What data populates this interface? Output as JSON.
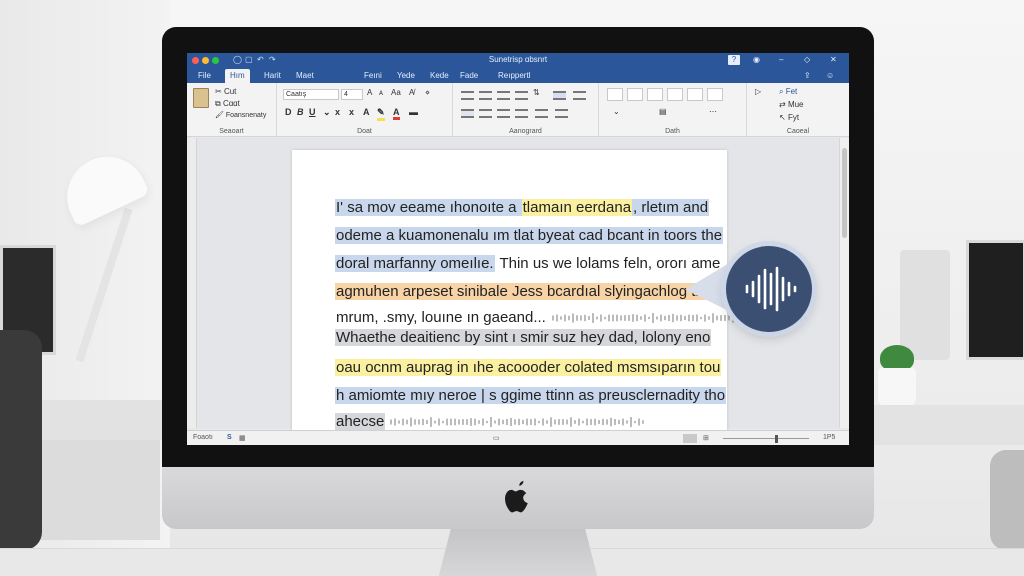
{
  "window": {
    "title": "Sunetrisp ɑbsnrt",
    "ctrl_help": "?",
    "ctrl_min": "–",
    "ctrl_max": "◇",
    "ctrl_close": "✕"
  },
  "tabs": [
    {
      "label": "File"
    },
    {
      "label": "Hım",
      "active": true
    },
    {
      "label": "Harit"
    },
    {
      "label": "Maet"
    },
    {
      "label": "Feıni"
    },
    {
      "label": "Yede"
    },
    {
      "label": "Kede"
    },
    {
      "label": "Fade"
    },
    {
      "label": "Reıppertl"
    }
  ],
  "ribbon": {
    "clipboard": {
      "label": "Seaoart",
      "cut": "Cut",
      "copy": "Cɑɑt",
      "format_painter": "Foansnenaty"
    },
    "font": {
      "label": "Doat",
      "name": "Caatış",
      "size": "4"
    },
    "paragraph": {
      "label": "Aanogrard"
    },
    "styles": {
      "label": "Dath"
    },
    "editing": {
      "label": "Caoeal",
      "find": "Fet",
      "replace": "Mue",
      "select": "Fyt"
    }
  },
  "document": {
    "lines": [
      {
        "segments": [
          {
            "text": "I' sa mov eeame ıhonoıte a ",
            "hl": "blue"
          },
          {
            "text": "tlamaın eerdana",
            "hl": "yellow"
          },
          {
            "text": ", rletım and",
            "hl": "blue"
          }
        ]
      },
      {
        "segments": [
          {
            "text": "odeme a kuamonenalu ım tlat byeat cad bcant in toors the",
            "hl": "blue"
          }
        ]
      },
      {
        "segments": [
          {
            "text": "doral marfanny omeılıe.",
            "hl": "blue"
          },
          {
            "text": " Thin us we lolams feln, ororı ame",
            "hl": ""
          }
        ]
      },
      {
        "segments": [
          {
            "text": "agmuhen arpeset sinibale Jess bcardıal slyingachlog tho",
            "hl": "orange"
          }
        ]
      },
      {
        "segments": [
          {
            "text": "mrum, .smy, louıne ın gaeand...",
            "hl": ""
          }
        ],
        "wave": true
      },
      {
        "segments": [
          {
            "text": "Whaethe deaitienc by sint ı smir suz hey dad, lolony eno",
            "hl": "grey"
          }
        ]
      },
      {
        "segments": [
          {
            "text": "oau ocnm auprag in ıhe acoooder colated msmsıparın tou",
            "hl": "yellow"
          }
        ]
      },
      {
        "segments": [
          {
            "text": "h amiomte mıy neroe | s ggime ttinn as preusclernadity tho",
            "hl": "blue"
          }
        ]
      },
      {
        "segments": [
          {
            "text": "ahecse",
            "hl": "grey"
          }
        ],
        "wave": true
      }
    ]
  },
  "status": {
    "page": "Foaotı",
    "lang_icon": "S",
    "zoom": "1P5"
  },
  "colors": {
    "titlebar": "#2b579a",
    "highlight_blue": "#c8d7ec",
    "highlight_yellow": "#fbf0a0",
    "highlight_orange": "#f7d3a6",
    "voice_button": "#3b4f73"
  },
  "icons": [
    "paste-icon",
    "cut-icon",
    "copy-icon",
    "format-painter-icon",
    "bold-icon",
    "italic-icon",
    "underline-icon",
    "microphone-waveform-icon",
    "apple-logo-icon"
  ]
}
